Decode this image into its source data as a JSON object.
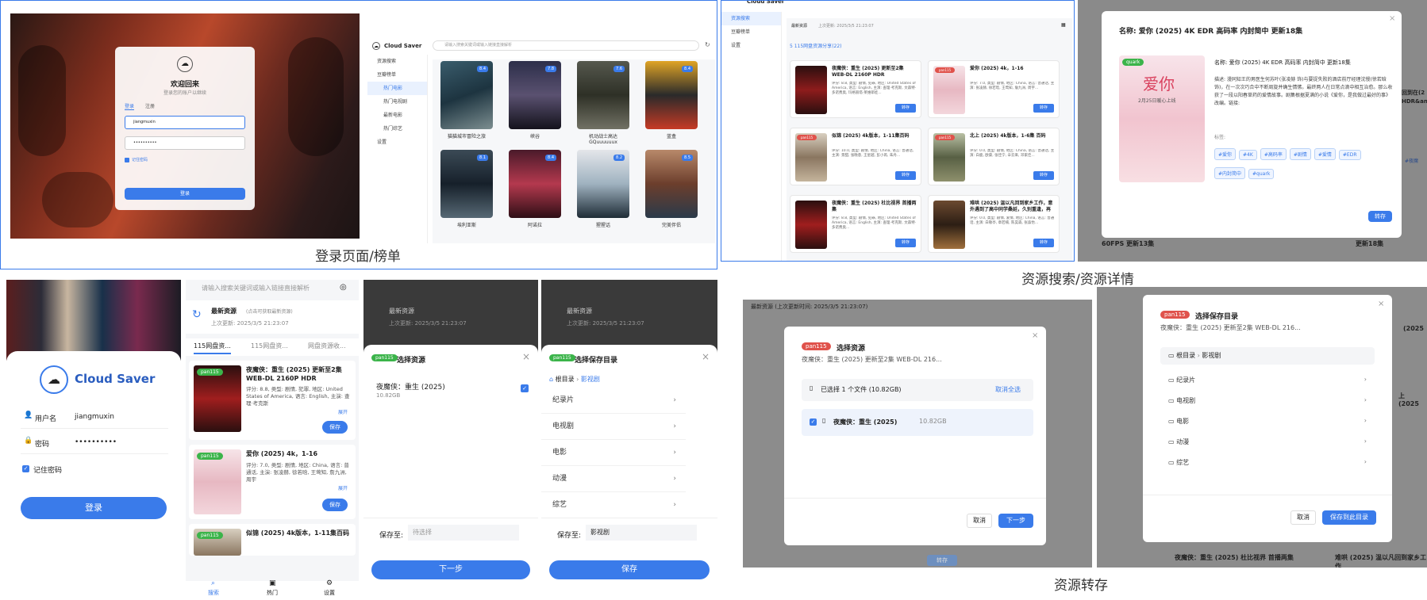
{
  "captions": {
    "q1": "登录页面/榜单",
    "q2": "资源搜索/资源详情",
    "q4": "资源转存"
  },
  "colors": {
    "accent": "#3a7bea",
    "pan115": "#e0524b",
    "quark": "#3bb44a"
  },
  "login": {
    "welcome": "欢迎回来",
    "subtitle": "登录您的账户以继续",
    "tab_login": "登录",
    "tab_register": "注册",
    "username": "jiangmuxin",
    "password": "••••••••••",
    "remember": "记住密码",
    "submit": "登录"
  },
  "app": {
    "name": "Cloud Saver",
    "search_placeholder": "请输入搜索关键词或输入链接直接解析"
  },
  "nav": {
    "search": "资源搜索",
    "ranking": "豆瓣榜单",
    "hot_movies": "热门电影",
    "hot_tv": "热门电视剧",
    "latest_movies": "最新电影",
    "hot_variety": "热门综艺",
    "settings": "设置"
  },
  "posters": [
    {
      "title": "猫猫城市冒险之旅",
      "score": "8.4"
    },
    {
      "title": "峡谷",
      "score": "7.8"
    },
    {
      "title": "机动战士高达GQuuuuuux",
      "score": "7.6"
    },
    {
      "title": "蓝盒",
      "score": "8.4"
    },
    {
      "title": "埃利亚斯",
      "score": "8.1"
    },
    {
      "title": "阿诺拉",
      "score": "8.4"
    },
    {
      "title": "猩猩话",
      "score": "8.2"
    },
    {
      "title": "完美伴侣",
      "score": "8.5"
    }
  ],
  "search": {
    "latest_title": "最新资源",
    "latest_hint": "(点击可获取最新资源)",
    "last_update": "上次更新: 2025/3/5 21:23:07",
    "group_title": "115网盘资源分享",
    "group_count": "(22)",
    "save_btn": "转存",
    "results": [
      {
        "title": "夜魔侠：重生 (2025) 更新至2集 WEB-DL 2160P HDR",
        "desc": "评分: 8.8, 类型: 剧情, 犯罪, 地区: United States of America, 语言: English, 主演: 查理·考克斯, 文森特·多诺费奥, 玛格丽塔·莱维耶娃..."
      },
      {
        "title": "爱你 (2025) 4k，1-16",
        "desc": "评分: 7.0, 类型: 剧情, 地区: China, 语言: 普通话, 主演: 张凌赫, 徐若晗, 王莺知, 詹九洲, 周宇..."
      },
      {
        "title": "似锦 (2025) 4k版本，1-11集百码",
        "desc": "评分: 10.0, 类型: 剧情, 地区: China, 语言: 普通话, 主演: 景甜, 张晚意, 王星越, 彭小苒, 朱丹..."
      },
      {
        "title": "北上 (2025) 4k版本，1-6集 百码",
        "desc": "评分: 0.0, 类型: 剧情, 地区: China, 语言: 普通话, 主演: 白鹿, 欧豪, 张佳宁, 辛云来, 邓家佳..."
      },
      {
        "title": "夜魔侠：重生 (2025) 杜比视界 首播两集",
        "desc": "评分: 8.8, 类型: 剧情, 犯罪, 地区: United States of America, 语言: English, 主演: 查理·考克斯, 文森特·多诺费奥..."
      },
      {
        "title": "难哄 (2025) 温以凡回到家乡工作，意外遇到了高中同学桑延，久别重逢，再",
        "desc": "评分: 0.0, 类型: 剧情, 爱情, 地区: China, 语言: 普通话, 主演: 白敬亭, 章若楠, 陈昊森, 张淼怡..."
      }
    ]
  },
  "detail": {
    "header": "名称: 爱你 (2025) 4K EDR 高码率 内封简中 更新18集",
    "name": "名称: 爱你 (2025) 4K EDR 高码率 内封简中 更新18集",
    "desc": "描述: 漫同知王的男医生何苏叶(张凌赫 饰)与要捉失败的酒店前厅经理沈慢(徐若晗 饰)，在一次次巧合中不断周旋并确生情愫。最终两人在日常点滴中相互治愈。那么收获了一段以阳春草药的爱情故事。剧集根据夏满的小说《爱你，是我做过最好的事》改编。链接:",
    "tags_label": "标签:",
    "tags": [
      "#爱你",
      "#4K",
      "#高码率",
      "#剧情",
      "#爱情",
      "#EDR",
      "#内封简中",
      "#quark"
    ],
    "poster_text": "爱你",
    "poster_date": "2月25日暖心上线",
    "save": "转存",
    "side1": "回到在(2",
    "side2": "HDR&an",
    "side3": "#夜魔",
    "side4": "60FPS 更新13集",
    "side5": "更新18集"
  },
  "mobile": {
    "app": "Cloud Saver",
    "username_label": "用户名",
    "username": "jiangmuxin",
    "password_label": "密码",
    "password": "••••••••••",
    "remember": "记住密码",
    "login": "登录",
    "search_placeholder": "请输入搜索关键词或输入链接直接解析",
    "latest_title": "最新资源",
    "latest_hint": "(点击可获取最新资源)",
    "last_update": "上次更新: 2025/3/5 21:23:07",
    "tabs": [
      "115网盘资...",
      "115网盘资...",
      "网盘资源收..."
    ],
    "results": [
      {
        "title": "夜魔侠：重生 (2025) 更新至2集 WEB-DL 2160P HDR",
        "desc": "评分: 8.8, 类型: 剧情, 犯罪, 地区: United States of America, 语言: English, 主演: 查理·考克斯"
      },
      {
        "title": "爱你 (2025) 4k，1-16",
        "desc": "评分: 7.0, 类型: 剧情, 地区: China, 语言: 普通话, 主演: 张凌赫, 徐若晗, 王莺知, 詹九洲, 周宇"
      },
      {
        "title": "似锦 (2025) 4k版本，1-11集百码",
        "desc": ""
      }
    ],
    "expand": "展开",
    "save": "保存",
    "bottom_nav": [
      "搜索",
      "热门",
      "设置"
    ],
    "select_title": "选择资源",
    "file_name": "夜魔侠：重生 (2025)",
    "file_size": "10.82GB",
    "save_to": "保存至:",
    "save_to_placeholder": "待选择",
    "next": "下一步",
    "dir_title": "选择保存目录",
    "root": "根目录",
    "current": "影视剧",
    "folders": [
      "纪录片",
      "电视剧",
      "电影",
      "动漫",
      "综艺"
    ],
    "save_to_value": "影视剧"
  },
  "transfer": {
    "select_title": "选择资源",
    "subtitle": "夜魔侠：重生 (2025) 更新至2集 WEB-DL 216...",
    "selected": "已选择 1 个文件  (10.82GB)",
    "cancel_all": "取消全选",
    "file_name": "夜魔侠：重生 (2025)",
    "file_size": "10.82GB",
    "cancel": "取消",
    "next": "下一步",
    "dir_title": "选择保存目录",
    "root": "根目录",
    "current": "影视剧",
    "folders": [
      "纪录片",
      "电视剧",
      "电影",
      "动漫",
      "综艺"
    ],
    "save_here": "保存到此目录",
    "bg_latest": "最新资源",
    "bg_update": "(上次更新时间: 2025/3/5 21:23:07)",
    "bg_save": "转存",
    "side_a": "夜魔侠：重生 (2025) 杜比视界 首播两集",
    "side_b": "难哄 (2025) 温以凡回到家乡工作",
    "side_c": "(2025",
    "side_d": "北上 (2025",
    "side_e": "上 (2025"
  },
  "badges": {
    "pan115": "pan115",
    "quark": "quark"
  }
}
